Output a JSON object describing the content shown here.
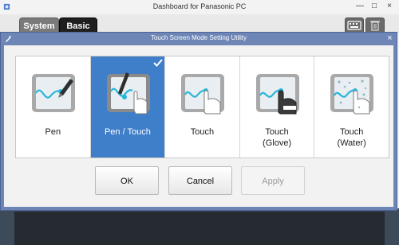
{
  "background_window": {
    "title": "Dashboard for Panasonic PC",
    "tabs": [
      {
        "label": "System"
      },
      {
        "label": "Basic"
      }
    ],
    "window_controls": {
      "minimize": "—",
      "maximize": "□",
      "close": "×"
    }
  },
  "dialog": {
    "title": "Touch Screen Mode Setting Utility",
    "close_glyph": "×",
    "modes": [
      {
        "line1": "Pen",
        "line2": "",
        "icon": "pen-mode-icon",
        "selected": false
      },
      {
        "line1": "Pen / Touch",
        "line2": "",
        "icon": "pen-touch-mode-icon",
        "selected": true
      },
      {
        "line1": "Touch",
        "line2": "",
        "icon": "touch-mode-icon",
        "selected": false
      },
      {
        "line1": "Touch",
        "line2": "(Glove)",
        "icon": "touch-glove-mode-icon",
        "selected": false
      },
      {
        "line1": "Touch",
        "line2": "(Water)",
        "icon": "touch-water-mode-icon",
        "selected": false
      }
    ],
    "buttons": {
      "ok": "OK",
      "cancel": "Cancel",
      "apply": "Apply"
    },
    "apply_enabled": false
  },
  "colors": {
    "selection": "#3f7ec8",
    "dialog_frame": "#6e86b6",
    "cyan_stroke": "#29b6d8"
  }
}
